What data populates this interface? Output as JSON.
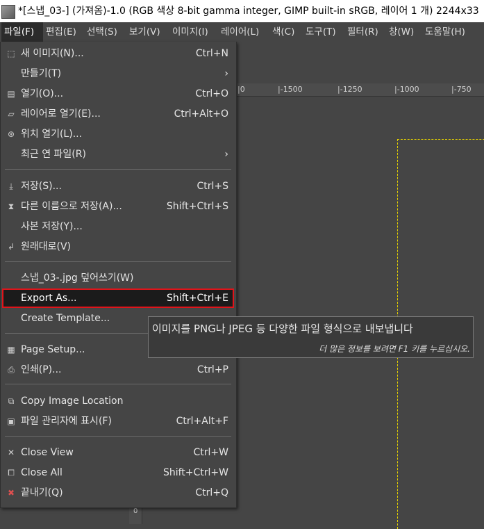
{
  "window": {
    "title": "*[스냅_03-] (가져옴)-1.0 (RGB 색상 8-bit gamma integer, GIMP built-in sRGB, 레이어 1 개) 2244x33"
  },
  "menubar": {
    "items": [
      {
        "label": "파일(F)",
        "active": true
      },
      {
        "label": "편집(E)"
      },
      {
        "label": "선택(S)"
      },
      {
        "label": "보기(V)"
      },
      {
        "label": "이미지(I)"
      },
      {
        "label": "레이어(L)"
      },
      {
        "label": "색(C)"
      },
      {
        "label": "도구(T)"
      },
      {
        "label": "필터(R)"
      },
      {
        "label": "창(W)"
      },
      {
        "label": "도움말(H)"
      }
    ]
  },
  "file_menu": {
    "new_image": {
      "label": "새 이미지(N)...",
      "shortcut": "Ctrl+N",
      "icon": "new-image-icon"
    },
    "create": {
      "label": "만들기(T)",
      "arrow": "›"
    },
    "open": {
      "label": "열기(O)...",
      "shortcut": "Ctrl+O",
      "icon": "open-icon"
    },
    "open_as_layers": {
      "label": "레이어로 열기(E)...",
      "shortcut": "Ctrl+Alt+O",
      "icon": "open-as-layers-icon"
    },
    "open_location": {
      "label": "위치 열기(L)...",
      "icon": "globe-icon"
    },
    "recent": {
      "label": "최근 연 파일(R)",
      "arrow": "›"
    },
    "save": {
      "label": "저장(S)...",
      "shortcut": "Ctrl+S",
      "icon": "save-icon"
    },
    "save_as": {
      "label": "다른 이름으로 저장(A)...",
      "shortcut": "Shift+Ctrl+S",
      "icon": "save-as-icon"
    },
    "save_copy": {
      "label": "사본 저장(Y)..."
    },
    "revert": {
      "label": "원래대로(V)",
      "icon": "revert-icon"
    },
    "overwrite": {
      "label": "스냅_03-.jpg 덮어쓰기(W)"
    },
    "export_as": {
      "label": "Export As...",
      "shortcut": "Shift+Ctrl+E"
    },
    "create_template": {
      "label": "Create Template..."
    },
    "page_setup": {
      "label": "Page Setup...",
      "icon": "page-setup-icon"
    },
    "print": {
      "label": "인쇄(P)...",
      "shortcut": "Ctrl+P",
      "icon": "print-icon"
    },
    "copy_location": {
      "label": "Copy Image Location",
      "icon": "copy-location-icon"
    },
    "show_in_manager": {
      "label": "파일 관리자에 표시(F)",
      "shortcut": "Ctrl+Alt+F",
      "icon": "file-manager-icon"
    },
    "close_view": {
      "label": "Close View",
      "shortcut": "Ctrl+W",
      "icon": "close-icon"
    },
    "close_all": {
      "label": "Close All",
      "shortcut": "Shift+Ctrl+W",
      "icon": "close-all-icon"
    },
    "quit": {
      "label": "끝내기(Q)",
      "shortcut": "Ctrl+Q",
      "icon": "quit-icon"
    }
  },
  "tooltip": {
    "text": "이미지를 PNG나 JPEG 등 다양한 파일 형식으로 내보냅니다",
    "hint": "더 많은 정보를 보려면 F1 키를 누르십시오."
  },
  "ruler": {
    "ticks": [
      "1500",
      "1250",
      "1000",
      "750"
    ],
    "left_tick": "0"
  },
  "colors": {
    "highlight_border": "#e0141a",
    "selection_dash": "#e6d200",
    "menu_bg": "#454545"
  }
}
